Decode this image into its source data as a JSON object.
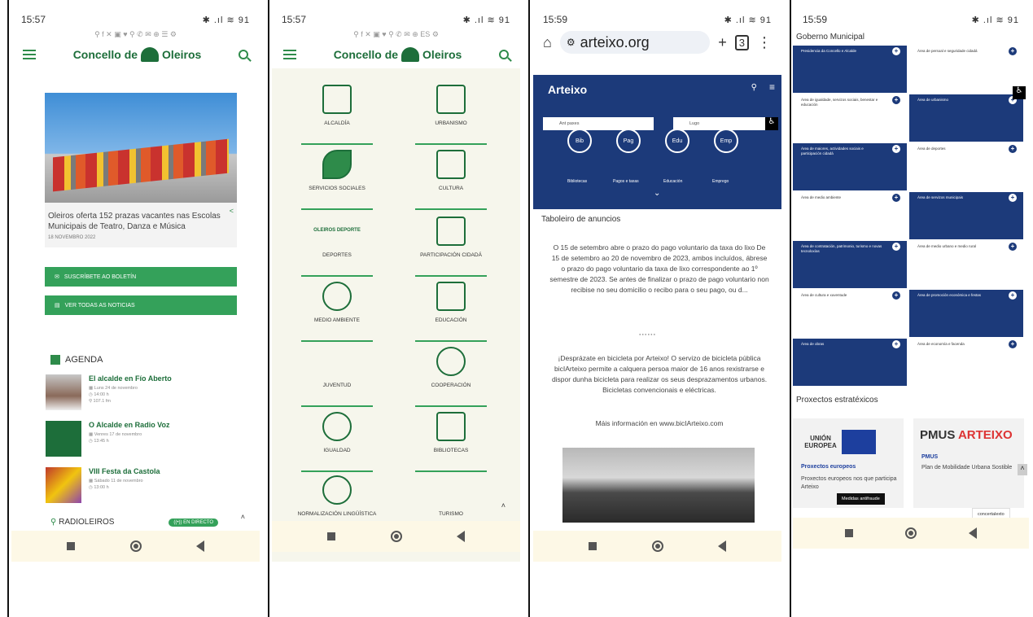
{
  "panel1": {
    "status_time": "15:57",
    "status_right": "✱ .ıl ≋ 91",
    "social_icons": "⚲ f ✕ ▣ ♥   ⚲ ✆ ✉   ⊕ ☰ ⚙",
    "site_title_left": "Concello de",
    "site_title_right": "Oleiros",
    "news_text": "Oleiros oferta 152 prazas vacantes nas Escolas Municipais de Teatro, Danza e Música",
    "news_date": "18 NOVEMBRO 2022",
    "btn_newsletter": "SUSCRÍBETE AO BOLETÍN",
    "btn_news": "VER TODAS AS NOTICIAS",
    "agenda_label": "AGENDA",
    "agenda": [
      {
        "title": "El alcalde en Fío Aberto",
        "meta1": "▦ Luns 24 de novembro",
        "meta2": "◷ 14:00 h",
        "meta3": "⚲ 107.1 fm"
      },
      {
        "title": "O Alcalde en Radio Voz",
        "meta1": "▦ Venres 17 de novembro",
        "meta2": "◷ 13:45 h",
        "meta3": ""
      },
      {
        "title": "VIII Festa da Castola",
        "meta1": "▦ Sábado 11 de novembro",
        "meta2": "◷ 13:00 h",
        "meta3": ""
      }
    ],
    "radio_label": "RADIOLEIROS",
    "live_label": "((•)) EN DIRECTO"
  },
  "panel2": {
    "status_time": "15:57",
    "status_right": "✱ .ıl ≋ 91",
    "social_icons": "⚲ f ✕ ▣ ♥   ⚲ ✆ ✉   ⊕ ES ⚙",
    "site_title_left": "Concello de",
    "site_title_right": "Oleiros",
    "tiles": [
      "ALCALDÍA",
      "URBANISMO",
      "SERVICIOS SOCIALES",
      "CULTURA",
      "DEPORTES",
      "PARTICIPACIÓN CIDADÁ",
      "MEDIO AMBIENTE",
      "EDUCACIÓN",
      "JUVENTUD",
      "COOPERACIÓN",
      "IGUALDAD",
      "BIBLIOTECAS",
      "NORMALIZACIÓN LINGÜÍSTICA",
      "TURISMO"
    ],
    "deporte_logo": "OLEIROS DEPORTE"
  },
  "panel3": {
    "status_time": "15:59",
    "status_right": "✱ .ıl ≋ 91",
    "url": "arteixo.org",
    "brand": "Arteixo",
    "field1": "Ant paxes",
    "field2": "Lugo",
    "circles": [
      "Bib",
      "Pag",
      "Edu",
      "Emp"
    ],
    "circle_labels": [
      "Bibliotecas",
      "Pagos e taxas",
      "Educación",
      "Emprego"
    ],
    "board_title": "Taboleiro de anuncios",
    "ann1": "O 15 de setembro abre o prazo do pago voluntario da taxa do lixo De 15 de setembro ao 20 de novembro de 2023, ambos incluídos, ábrese o prazo do pago voluntario da taxa de lixo correspondente ao 1º semestre de 2023. Se antes de finalizar o prazo de pago voluntario non recibise no seu domicilio o recibo para o seu pago, ou d...",
    "ann2": "¡Desprázate en bicicleta por Arteixo! O servizo de bicicleta pública bicIArteixo permite a calquera persoa maior de 16 anos rexistrarse e dispor dunha bicicleta para realizar os seus desprazamentos urbanos. Bicicletas convencionais e eléctricas.",
    "ann3": "Máis información en www.bicIArteixo.com",
    "dots": "● ● ● ● ● ●"
  },
  "panel4": {
    "status_time": "15:59",
    "status_right": "✱ .ıl ≋ 91",
    "gov_title": "Goberno Municipal",
    "areas": [
      "Presidencia da Concello e Alcalde",
      "Área de persoal e seguridade cidadá",
      "Área de igualdade, servizos sociais, benestar e educación",
      "Área de urbanismo",
      "Área de maiores, actividades sociais e participación cidadá",
      "Área de deportes",
      "Área de medio ambiente",
      "Área de servizos municipais",
      "Área de contratación, patrimonio, turismo e novas tecnoloxías",
      "Área de medio urbano e medio rural",
      "Área de cultura e xuventude",
      "Área de promoción económica e festas",
      "Área de obras",
      "Área de economía e facenda"
    ],
    "proj_title": "Proxectos estratéxicos",
    "eu_label": "UNIÓN EUROPEA",
    "eu_link": "Proxectos europeos",
    "eu_desc": "Proxectos europeos nos que participa Arteixo",
    "pmus_logo": "PMUS",
    "pmus_logo_right": "ARTEIXO",
    "pmus_title": "PMUS",
    "pmus_desc": "Plan de Mobilidade Urbana Sostible",
    "tooltip1": "Medidas antifraude",
    "tooltip2": "concertalexto",
    "colors": {
      "blue": "#1c3a7a",
      "green": "#34a15a"
    }
  }
}
